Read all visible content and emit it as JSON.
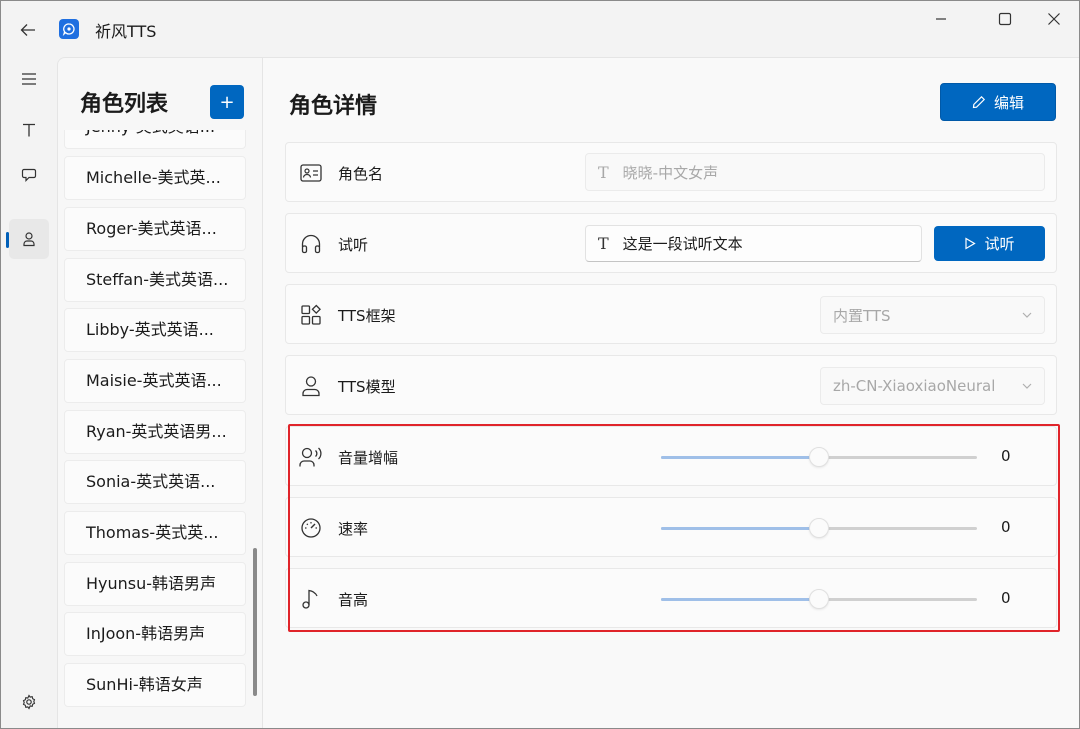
{
  "app": {
    "title": "祈风TTS"
  },
  "colors": {
    "accent": "#0067c0",
    "highlight": "#e0242a"
  },
  "rail": {
    "items": [
      {
        "name": "menu",
        "icon": "hamburger-menu-icon"
      },
      {
        "name": "text",
        "icon": "text-t-icon"
      },
      {
        "name": "chat",
        "icon": "chat-bubble-icon"
      },
      {
        "name": "roles",
        "icon": "person-icon",
        "active": true
      },
      {
        "name": "settings",
        "icon": "gear-icon"
      }
    ]
  },
  "role_list": {
    "title": "角色列表",
    "add_label": "+",
    "items": [
      "Jenny-美式英语...",
      "Michelle-美式英...",
      "Roger-美式英语...",
      "Steffan-美式英语...",
      "Libby-英式英语...",
      "Maisie-英式英语...",
      "Ryan-英式英语男...",
      "Sonia-英式英语...",
      "Thomas-英式英...",
      "Hyunsu-韩语男声",
      "InJoon-韩语男声",
      "SunHi-韩语女声"
    ]
  },
  "detail": {
    "title": "角色详情",
    "edit_label": "编辑",
    "name_row": {
      "label": "角色名",
      "placeholder": "晓晓-中文女声"
    },
    "preview_row": {
      "label": "试听",
      "value": "这是一段试听文本",
      "button": "试听"
    },
    "framework_row": {
      "label": "TTS框架",
      "value": "内置TTS"
    },
    "model_row": {
      "label": "TTS模型",
      "value": "zh-CN-XiaoxiaoNeural"
    },
    "sliders": [
      {
        "label": "音量增幅",
        "value": "0",
        "icon": "volume-speaking-icon",
        "fraction": 0.5
      },
      {
        "label": "速率",
        "value": "0",
        "icon": "speedometer-icon",
        "fraction": 0.5
      },
      {
        "label": "音高",
        "value": "0",
        "icon": "music-note-icon",
        "fraction": 0.5
      }
    ]
  }
}
